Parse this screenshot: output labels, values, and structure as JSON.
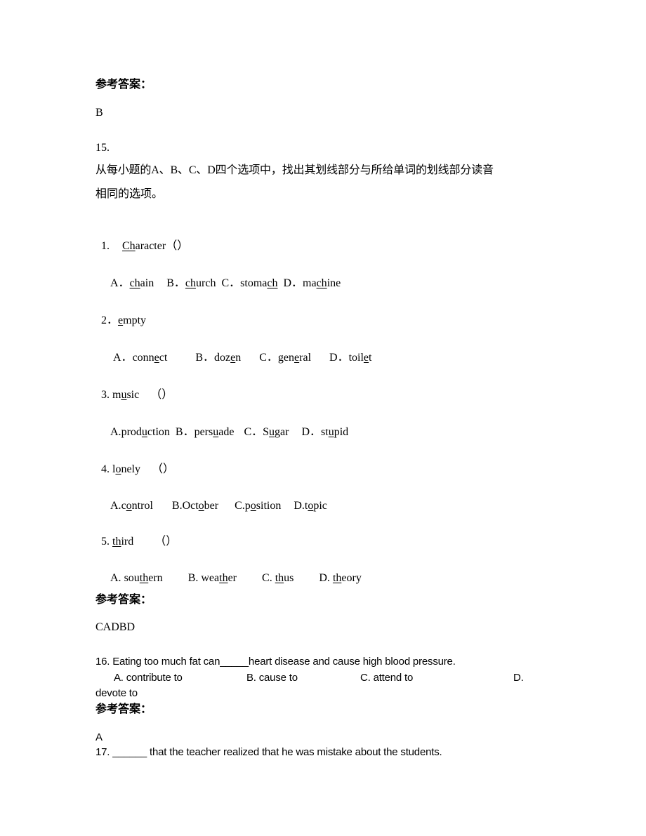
{
  "answer_label": "参考答案：",
  "q14": {
    "answer": "B"
  },
  "q15": {
    "number": "15.",
    "instruction_line1": "从每小题的A、B、C、D四个选项中，找出其划线部分与所给单词的划线部分读音",
    "instruction_line2": "相同的选项。",
    "items": [
      {
        "label": "1.",
        "word": {
          "pre": "",
          "ul": "Ch",
          "post": "aracter"
        },
        "blank": "（）",
        "options": [
          {
            "letter": "A．",
            "pre": "",
            "ul": "ch",
            "post": "ain"
          },
          {
            "letter": "B．",
            "pre": "",
            "ul": "ch",
            "post": "urch"
          },
          {
            "letter": "C．",
            "pre": "stoma",
            "ul": "ch",
            "post": ""
          },
          {
            "letter": "D．",
            "pre": "ma",
            "ul": "ch",
            "post": "ine"
          }
        ]
      },
      {
        "label": "2．",
        "word": {
          "pre": "",
          "ul": "e",
          "post": "mpty"
        },
        "blank": "",
        "options": [
          {
            "letter": "A．",
            "pre": "conn",
            "ul": "e",
            "post": "ct"
          },
          {
            "letter": "B．",
            "pre": "doz",
            "ul": "e",
            "post": "n"
          },
          {
            "letter": "C．",
            "pre": "gen",
            "ul": "e",
            "post": "ral"
          },
          {
            "letter": "D．",
            "pre": "toil",
            "ul": "e",
            "post": "t"
          }
        ]
      },
      {
        "label": "3.",
        "word": {
          "pre": "m",
          "ul": "u",
          "post": "sic"
        },
        "blank": "（）",
        "options": [
          {
            "letter": "A.",
            "pre": "prod",
            "ul": "u",
            "post": "ction"
          },
          {
            "letter": "B．",
            "pre": "pers",
            "ul": "u",
            "post": "ade"
          },
          {
            "letter": "C．",
            "pre": "S",
            "ul": "u",
            "post": "gar"
          },
          {
            "letter": "D．",
            "pre": "st",
            "ul": "u",
            "post": "pid"
          }
        ]
      },
      {
        "label": "4.",
        "word": {
          "pre": "l",
          "ul": "o",
          "post": "nely"
        },
        "blank": "（）",
        "options": [
          {
            "letter": "A.",
            "pre": "c",
            "ul": "o",
            "post": "ntrol"
          },
          {
            "letter": "B.",
            "pre": "Oct",
            "ul": "o",
            "post": "ber"
          },
          {
            "letter": "C.",
            "pre": "p",
            "ul": "o",
            "post": "sition"
          },
          {
            "letter": "D.",
            "pre": "t",
            "ul": "o",
            "post": "pic"
          }
        ]
      },
      {
        "label": "5.",
        "word": {
          "pre": "",
          "ul": "th",
          "post": "ird"
        },
        "blank": "（）",
        "options": [
          {
            "letter": "A. ",
            "pre": "sou",
            "ul": "th",
            "post": "ern"
          },
          {
            "letter": "B. ",
            "pre": "wea",
            "ul": "th",
            "post": "er"
          },
          {
            "letter": "C. ",
            "pre": "",
            "ul": "th",
            "post": "us"
          },
          {
            "letter": "D. ",
            "pre": "",
            "ul": "th",
            "post": "eory"
          }
        ]
      }
    ],
    "answer": "CADBD"
  },
  "q16": {
    "stem": "16. Eating too much fat can_____heart disease and cause high blood pressure.",
    "options": [
      "A. contribute to",
      "B. cause to",
      "C. attend to",
      "D."
    ],
    "wrap": "devote to",
    "answer": "A"
  },
  "q17": {
    "stem": "17. ______ that the teacher realized that he was mistake about the students."
  }
}
